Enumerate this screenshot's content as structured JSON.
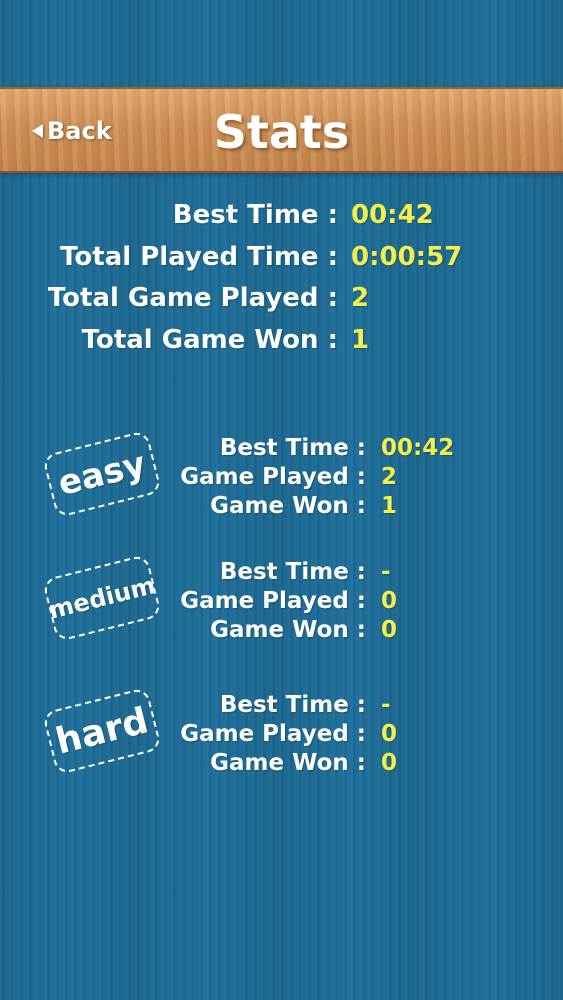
{
  "header": {
    "back_label": "Back",
    "title": "Stats"
  },
  "overall": {
    "best_time_label": "Best Time :",
    "best_time_value": "00:42",
    "total_played_time_label": "Total Played Time :",
    "total_played_time_value": "0:00:57",
    "total_game_played_label": "Total Game Played :",
    "total_game_played_value": "2",
    "total_game_won_label": "Total Game Won :",
    "total_game_won_value": "1"
  },
  "difficulties": {
    "easy": {
      "badge": "easy",
      "best_time_label": "Best Time :",
      "best_time_value": "00:42",
      "game_played_label": "Game Played :",
      "game_played_value": "2",
      "game_won_label": "Game Won :",
      "game_won_value": "1"
    },
    "medium": {
      "badge": "medium",
      "best_time_label": "Best Time :",
      "best_time_value": "-",
      "game_played_label": "Game Played :",
      "game_played_value": "0",
      "game_won_label": "Game Won :",
      "game_won_value": "0"
    },
    "hard": {
      "badge": "hard",
      "best_time_label": "Best Time :",
      "best_time_value": "-",
      "game_played_label": "Game Played :",
      "game_played_value": "0",
      "game_won_label": "Game Won :",
      "game_won_value": "0"
    }
  },
  "colors": {
    "background": "#1d6e99",
    "value_yellow": "#f2f04a",
    "header_wood": "#cf9258"
  }
}
